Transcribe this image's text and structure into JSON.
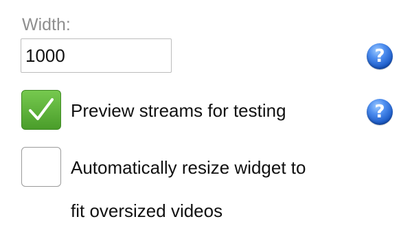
{
  "width_field": {
    "label": "Width:",
    "value": "1000"
  },
  "help_icon_glyph": "?",
  "options": [
    {
      "label": "Preview streams for testing",
      "checked": true
    },
    {
      "label_line1": "Automatically resize widget to",
      "label_line2": "fit oversized videos",
      "checked": false
    }
  ],
  "colors": {
    "checkbox_checked": "#5cb33a",
    "help_icon": "#2a6fd8",
    "label_muted": "#8e8e8e"
  },
  "icons": [
    "help-icon",
    "check-icon"
  ]
}
